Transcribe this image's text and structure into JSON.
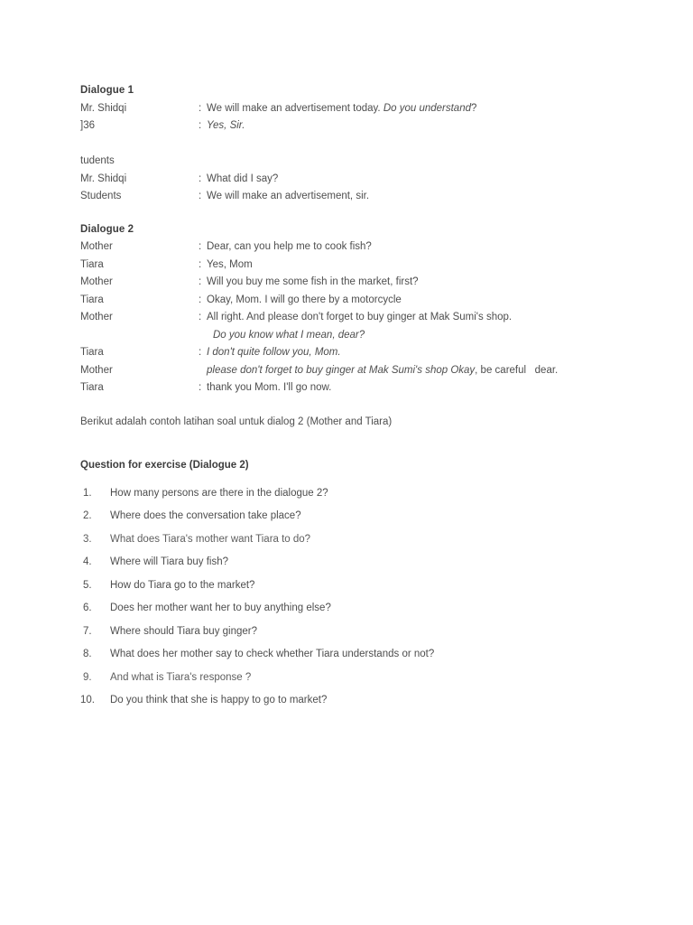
{
  "document": {
    "dialogue1": {
      "heading": "Dialogue 1",
      "lines": [
        {
          "speaker": "Mr. Shidqi",
          "colon": ":",
          "text_plain": "We will make an advertisement today. ",
          "text_italic": "Do you understand",
          "text_tail": "?"
        },
        {
          "speaker": "]36",
          "colon": ":",
          "text_plain": "",
          "text_italic": "Yes, Sir.",
          "text_tail": ""
        },
        {
          "speaker": "",
          "colon": "",
          "text_plain": "",
          "text_italic": "",
          "text_tail": ""
        },
        {
          "speaker": "tudents",
          "colon": "",
          "text_plain": "",
          "text_italic": "",
          "text_tail": ""
        },
        {
          "speaker": "Mr. Shidqi",
          "colon": ":",
          "text_plain": "What did I say?",
          "text_italic": "",
          "text_tail": ""
        },
        {
          "speaker": "Students",
          "colon": ":",
          "text_plain": "We will make an advertisement, sir.",
          "text_italic": "",
          "text_tail": ""
        }
      ]
    },
    "dialogue2": {
      "heading": "Dialogue 2",
      "lines": [
        {
          "speaker": "Mother",
          "colon": ":",
          "text_plain": "Dear, can you help me to cook fish?",
          "text_italic": "",
          "text_tail": ""
        },
        {
          "speaker": "Tiara",
          "colon": ":",
          "text_plain": "Yes, Mom",
          "text_italic": "",
          "text_tail": ""
        },
        {
          "speaker": "Mother",
          "colon": ":",
          "text_plain": "Will you buy me some fish in the market, first?",
          "text_italic": "",
          "text_tail": ""
        },
        {
          "speaker": "Tiara",
          "colon": ":",
          "text_plain": "Okay, Mom. I will go there by a motorcycle",
          "text_italic": "",
          "text_tail": ""
        },
        {
          "speaker": "Mother",
          "colon": ":",
          "text_plain": "All right. And please don't forget to buy ginger at Mak Sumi's shop.",
          "text_italic": "",
          "text_tail": ""
        }
      ],
      "continuation": "Do you know what I mean, dear?",
      "lines_after": [
        {
          "speaker": "Tiara",
          "colon": ":",
          "text_plain": "",
          "text_italic": "I don't quite follow you, Mom.",
          "text_tail": ""
        },
        {
          "speaker": "Mother",
          "colon": "",
          "text_plain": "",
          "text_italic": "please don't forget to buy ginger at Mak Sumi's shop Okay",
          "text_tail": ", be careful   dear."
        },
        {
          "speaker": "Tiara",
          "colon": ":",
          "text_plain": "thank you Mom. I'll go now.",
          "text_italic": "",
          "text_tail": ""
        }
      ]
    },
    "note": "Berikut adalah contoh latihan soal untuk dialog 2 (Mother and Tiara)",
    "questions_title": "Question for exercise (Dialogue 2)",
    "questions": [
      {
        "num": "1.",
        "text": "How many persons are there in the dialogue 2?"
      },
      {
        "num": "2.",
        "text": "Where does the conversation take place?"
      },
      {
        "num": "3.",
        "text": "What does Tiara's mother want Tiara to do?"
      },
      {
        "num": "4.",
        "text": "Where will Tiara buy fish?"
      },
      {
        "num": "5.",
        "text": "How do Tiara go to the market?"
      },
      {
        "num": "6.",
        "text": "Does her mother want her to buy anything else?"
      },
      {
        "num": "7.",
        "text": "Where should Tiara buy ginger?"
      },
      {
        "num": "8.",
        "text": "What does her mother say to check whether Tiara understands or not?"
      },
      {
        "num": "9.",
        "text": "And what is Tiara's response ?"
      },
      {
        "num": "10.",
        "text": "Do you think that she is happy to go to market?"
      }
    ]
  },
  "colors": {
    "page_background": "#ffffff",
    "body_text": "#4e4e4e",
    "heading_text": "#3d3d3d",
    "faint_text": "#5e5e5e"
  }
}
